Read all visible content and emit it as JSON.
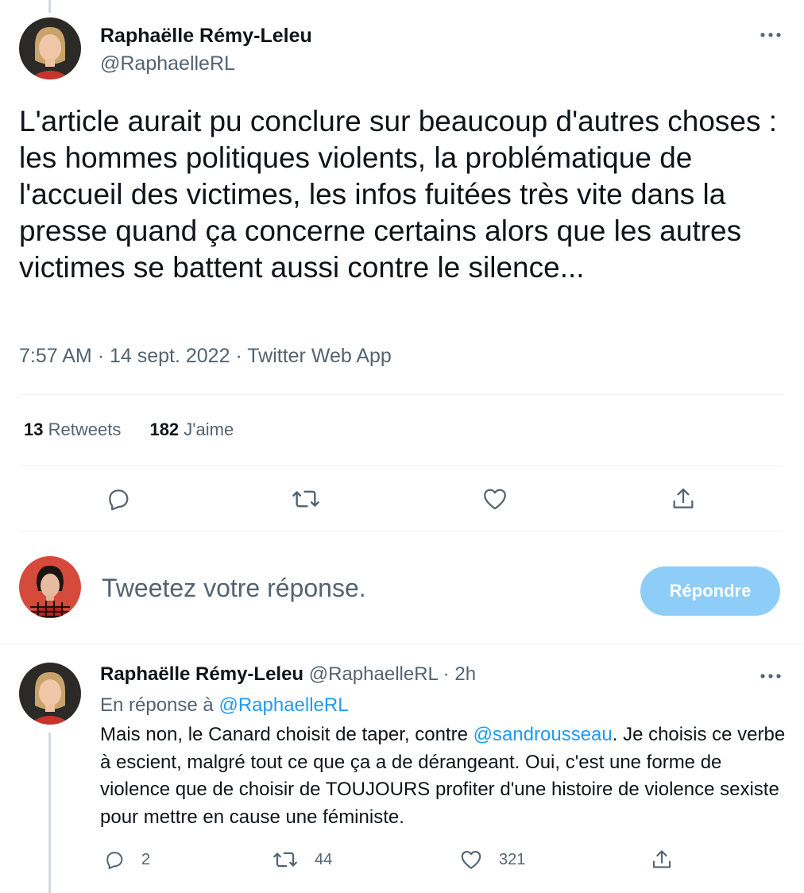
{
  "main_tweet": {
    "author_name": "Raphaëlle Rémy-Leleu",
    "author_handle": "@RaphaelleRL",
    "text": "L'article aurait pu conclure sur beaucoup d'autres choses : les hommes politiques violents, la problématique de l'accueil des victimes, les infos fuitées très vite dans la presse quand ça concerne certains alors que les autres victimes se battent aussi contre le silence...",
    "time": "7:57 AM",
    "date": "14 sept. 2022",
    "source": "Twitter Web App",
    "separator": "·",
    "retweets_count": "13",
    "retweets_label": "Retweets",
    "likes_count": "182",
    "likes_label": "J'aime",
    "icons": [
      "reply-icon",
      "retweet-icon",
      "like-icon",
      "share-icon"
    ]
  },
  "reply_box": {
    "placeholder": "Tweetez votre réponse.",
    "button_label": "Répondre"
  },
  "reply_tweet": {
    "author_name": "Raphaëlle Rémy-Leleu",
    "author_handle": "@RaphaelleRL",
    "separator": "·",
    "age": "2h",
    "in_reply_prefix": "En réponse à",
    "in_reply_handle": "@RaphaelleRL",
    "text_before_mention": "Mais non, le Canard choisit de taper, contre ",
    "mention": "@sandrousseau",
    "text_after_mention": ". Je choisis ce verbe à escient, malgré tout ce que ça a de dérangeant. Oui, c'est une forme de violence que de choisir de TOUJOURS profiter d'une histoire de violence sexiste pour mettre en cause une féministe.",
    "replies_count": "2",
    "retweets_count": "44",
    "likes_count": "321"
  },
  "colors": {
    "text": "#0f1419",
    "secondary": "#536471",
    "link": "#1d9bf0",
    "button_disabled": "#8ecdf8",
    "divider": "#eff3f4"
  }
}
